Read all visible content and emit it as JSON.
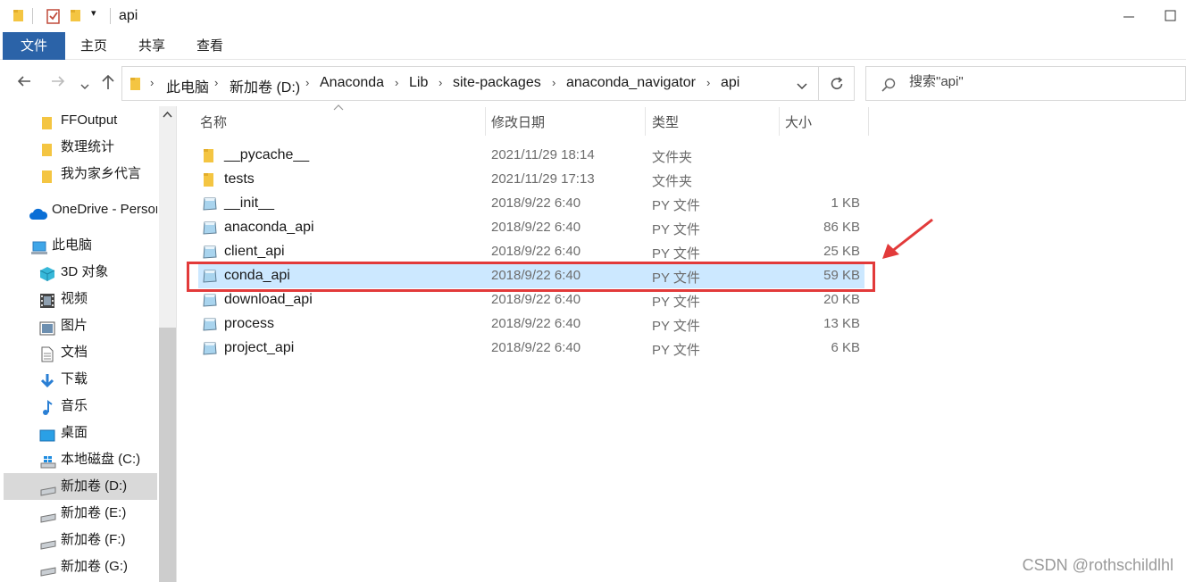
{
  "window": {
    "title": "api",
    "colors": {
      "folder": "#f4c542",
      "selection": "#cce8ff",
      "file_tab": "#2b63a8",
      "annotation": "#e23a3a"
    }
  },
  "ribbon": {
    "tabs": [
      "文件",
      "主页",
      "共享",
      "查看"
    ]
  },
  "address": {
    "crumbs": [
      "此电脑",
      "新加卷 (D:)",
      "Anaconda",
      "Lib",
      "site-packages",
      "anaconda_navigator",
      "api"
    ]
  },
  "search": {
    "placeholder": "搜索\"api\""
  },
  "nav": {
    "items": [
      {
        "label": "FFOutput",
        "icon": "folder-icon"
      },
      {
        "label": "数理统计",
        "icon": "folder-icon"
      },
      {
        "label": "我为家乡代言",
        "icon": "folder-icon"
      },
      {
        "label": "OneDrive - Personal",
        "icon": "onedrive-icon"
      },
      {
        "label": "此电脑",
        "icon": "this-pc-icon"
      },
      {
        "label": "3D 对象",
        "icon": "3d-objects-icon"
      },
      {
        "label": "视频",
        "icon": "videos-icon"
      },
      {
        "label": "图片",
        "icon": "pictures-icon"
      },
      {
        "label": "文档",
        "icon": "documents-icon"
      },
      {
        "label": "下载",
        "icon": "downloads-icon"
      },
      {
        "label": "音乐",
        "icon": "music-icon"
      },
      {
        "label": "桌面",
        "icon": "desktop-icon"
      },
      {
        "label": "本地磁盘 (C:)",
        "icon": "system-drive-icon"
      },
      {
        "label": "新加卷 (D:)",
        "icon": "drive-icon"
      },
      {
        "label": "新加卷 (E:)",
        "icon": "drive-icon"
      },
      {
        "label": "新加卷 (F:)",
        "icon": "drive-icon"
      },
      {
        "label": "新加卷 (G:)",
        "icon": "drive-icon"
      }
    ],
    "selected_label": "新加卷 (D:)"
  },
  "filelist": {
    "columns": {
      "name": "名称",
      "date": "修改日期",
      "type": "类型",
      "size": "大小"
    },
    "rows": [
      {
        "name": "__pycache__",
        "date": "2021/11/29 18:14",
        "type": "文件夹",
        "size": "",
        "icon": "folder-icon"
      },
      {
        "name": "tests",
        "date": "2021/11/29 17:13",
        "type": "文件夹",
        "size": "",
        "icon": "folder-icon"
      },
      {
        "name": "__init__",
        "date": "2018/9/22 6:40",
        "type": "PY 文件",
        "size": "1 KB",
        "icon": "python-file-icon"
      },
      {
        "name": "anaconda_api",
        "date": "2018/9/22 6:40",
        "type": "PY 文件",
        "size": "86 KB",
        "icon": "python-file-icon"
      },
      {
        "name": "client_api",
        "date": "2018/9/22 6:40",
        "type": "PY 文件",
        "size": "25 KB",
        "icon": "python-file-icon"
      },
      {
        "name": "conda_api",
        "date": "2018/9/22 6:40",
        "type": "PY 文件",
        "size": "59 KB",
        "icon": "python-file-icon"
      },
      {
        "name": "download_api",
        "date": "2018/9/22 6:40",
        "type": "PY 文件",
        "size": "20 KB",
        "icon": "python-file-icon"
      },
      {
        "name": "process",
        "date": "2018/9/22 6:40",
        "type": "PY 文件",
        "size": "13 KB",
        "icon": "python-file-icon"
      },
      {
        "name": "project_api",
        "date": "2018/9/22 6:40",
        "type": "PY 文件",
        "size": "6 KB",
        "icon": "python-file-icon"
      }
    ],
    "selected_name": "conda_api"
  },
  "watermark": "CSDN @rothschildlhl"
}
